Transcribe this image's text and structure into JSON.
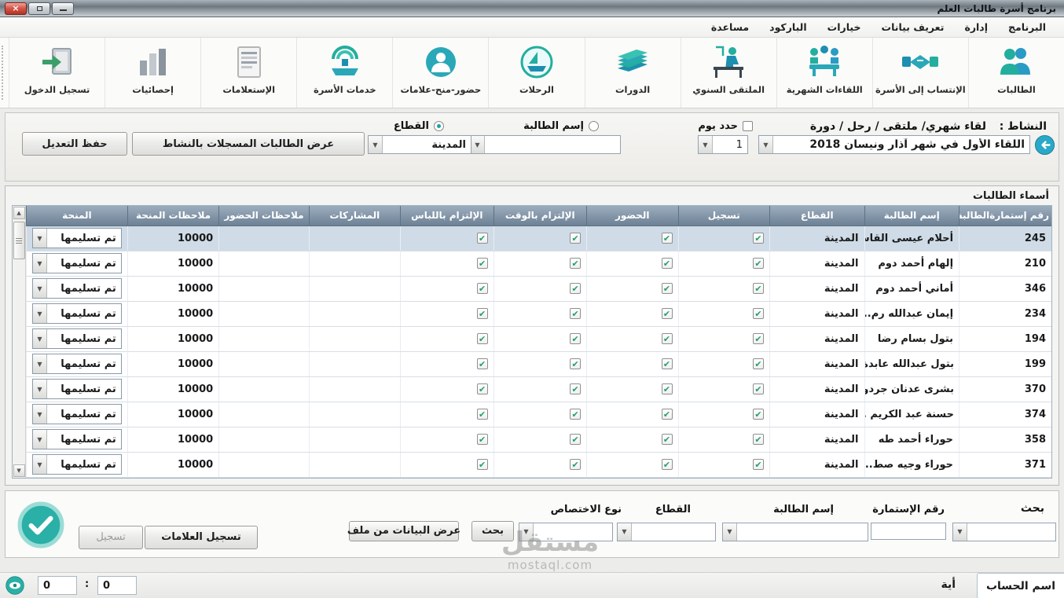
{
  "window": {
    "title": "برنامج أسرة طالبات العلم"
  },
  "menu": {
    "items": [
      "البرنامج",
      "إدارة",
      "تعريف بيانات",
      "خيارات",
      "الباركود",
      "مساعدة"
    ]
  },
  "toolbar": {
    "buttons": [
      {
        "label": "الطالبات",
        "icon": "students-icon"
      },
      {
        "label": "الإنتساب إلى الأسرة",
        "icon": "handshake-icon"
      },
      {
        "label": "اللقاءات الشهرية",
        "icon": "monthly-meetings-icon"
      },
      {
        "label": "الملتقى السنوي",
        "icon": "annual-forum-icon"
      },
      {
        "label": "الدورات",
        "icon": "courses-icon"
      },
      {
        "label": "الرحلات",
        "icon": "trips-icon"
      },
      {
        "label": "حضور-منح-علامات",
        "icon": "attendance-grants-icon"
      },
      {
        "label": "خدمات الأسرة",
        "icon": "family-services-icon"
      },
      {
        "label": "الإستعلامات",
        "icon": "inquiries-icon"
      },
      {
        "label": "إحصائيات",
        "icon": "statistics-icon"
      },
      {
        "label": "تسجيل الدخول",
        "icon": "login-icon"
      }
    ]
  },
  "filter": {
    "activity_label": "النشاط :",
    "activity_type": "لقاء شهري/ ملتقى / رحل / دورة",
    "activity_value": "اللقاء الأول في شهر آذار ونيسان 2018",
    "day_label": "حدد يوم",
    "day_value": "1",
    "student_radio": "إسم الطالبة",
    "student_value": "",
    "sector_radio": "القطاع",
    "sector_value": "المدينة",
    "show_registered_button": "عرض الطالبات المسجلات بالنشاط",
    "save_button": "حفظ التعديل"
  },
  "grid": {
    "title": "أسماء الطالبات",
    "columns": [
      "رقم إستمارةالطالبة",
      "إسم الطالبة",
      "القطاع",
      "تسجيل",
      "الحضور",
      "الإلتزام بالوقت",
      "الإلتزام باللباس",
      "المشاركات",
      "ملاحظات الحضور",
      "ملاحظات المنحة",
      "المنحة"
    ],
    "rows": [
      {
        "id": "245",
        "name": "أحلام عيسى القاسم",
        "sector": "المدينة",
        "registered": true,
        "attendance": true,
        "on_time": true,
        "dress_code": true,
        "participations": "",
        "attendance_notes": "",
        "grant_notes": "10000",
        "grant": "تم تسليمها"
      },
      {
        "id": "210",
        "name": "إلهام أحمد دوم",
        "sector": "المدينة",
        "registered": true,
        "attendance": true,
        "on_time": true,
        "dress_code": true,
        "participations": "",
        "attendance_notes": "",
        "grant_notes": "10000",
        "grant": "تم تسليمها"
      },
      {
        "id": "346",
        "name": "أماني أحمد دوم",
        "sector": "المدينة",
        "registered": true,
        "attendance": true,
        "on_time": true,
        "dress_code": true,
        "participations": "",
        "attendance_notes": "",
        "grant_notes": "10000",
        "grant": "تم تسليمها"
      },
      {
        "id": "234",
        "name": "إيمان عبدالله رم...",
        "sector": "المدينة",
        "registered": true,
        "attendance": true,
        "on_time": true,
        "dress_code": true,
        "participations": "",
        "attendance_notes": "",
        "grant_notes": "10000",
        "grant": "تم تسليمها"
      },
      {
        "id": "194",
        "name": "بتول بسام رضا",
        "sector": "المدينة",
        "registered": true,
        "attendance": true,
        "on_time": true,
        "dress_code": true,
        "participations": "",
        "attendance_notes": "",
        "grant_notes": "10000",
        "grant": "تم تسليمها"
      },
      {
        "id": "199",
        "name": "بتول عبدالله عابدة",
        "sector": "المدينة",
        "registered": true,
        "attendance": true,
        "on_time": true,
        "dress_code": true,
        "participations": "",
        "attendance_notes": "",
        "grant_notes": "10000",
        "grant": "تم تسليمها"
      },
      {
        "id": "370",
        "name": "بشرى عدنان جردو",
        "sector": "المدينة",
        "registered": true,
        "attendance": true,
        "on_time": true,
        "dress_code": true,
        "participations": "",
        "attendance_notes": "",
        "grant_notes": "10000",
        "grant": "تم تسليمها"
      },
      {
        "id": "374",
        "name": "حسنة عبد الكريم ...",
        "sector": "المدينة",
        "registered": true,
        "attendance": true,
        "on_time": true,
        "dress_code": true,
        "participations": "",
        "attendance_notes": "",
        "grant_notes": "10000",
        "grant": "تم تسليمها"
      },
      {
        "id": "358",
        "name": "حوراء أحمد طه",
        "sector": "المدينة",
        "registered": true,
        "attendance": true,
        "on_time": true,
        "dress_code": true,
        "participations": "",
        "attendance_notes": "",
        "grant_notes": "10000",
        "grant": "تم تسليمها"
      },
      {
        "id": "371",
        "name": "حوراء وجيه صط...",
        "sector": "المدينة",
        "registered": true,
        "attendance": true,
        "on_time": true,
        "dress_code": true,
        "participations": "",
        "attendance_notes": "",
        "grant_notes": "10000",
        "grant": "تم تسليمها"
      }
    ]
  },
  "search": {
    "title": "بحث",
    "form_number_label": "رقم الإستمارة",
    "student_name_label": "إسم الطالبة",
    "sector_label": "القطاع",
    "specialty_label": "نوع الاختصاص",
    "search_button": "بحث",
    "load_from_file_button": "عرض البيانات من ملف",
    "record_marks_button": "تسجيل العلامات",
    "record_button": "تسجيل"
  },
  "footer": {
    "account_label": "اسم الحساب",
    "account_value": "أية",
    "counter_left": "0",
    "counter_right": "0",
    "separator": ":"
  },
  "watermark": {
    "line1": "مستقل",
    "line2": "mostaql.com"
  }
}
